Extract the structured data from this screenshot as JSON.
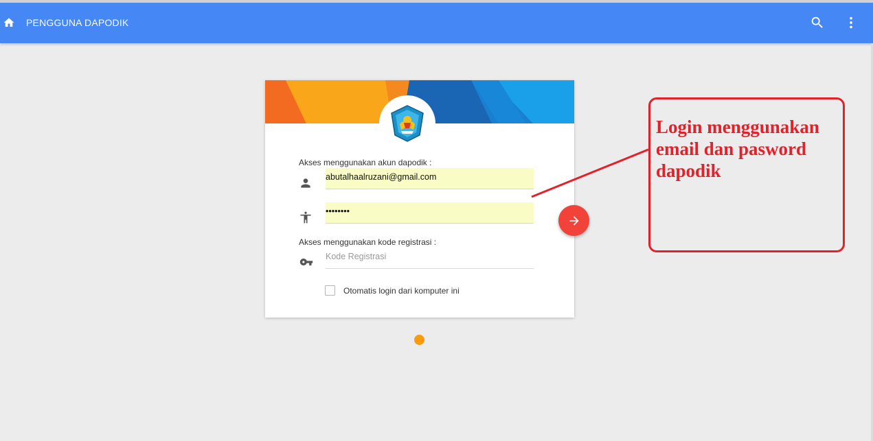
{
  "appbar": {
    "title": "PENGGUNA DAPODIK",
    "home_icon": "home-icon",
    "search_icon": "search-icon",
    "more_icon": "more-vert-icon",
    "color": "#4587f4"
  },
  "login_card": {
    "logo": "kemdikbud-logo",
    "account_section_label": "Akses menggunakan akun dapodik :",
    "email_field": {
      "value": "abutalhaalruzani@gmail.com",
      "icon": "person-icon"
    },
    "password_field": {
      "value": "••••••••",
      "icon": "accessibility-icon"
    },
    "registration_section_label": "Akses menggunakan kode registrasi :",
    "registration_field": {
      "placeholder": "Kode Registrasi",
      "icon": "key-icon"
    },
    "auto_login_label": "Otomatis login dari komputer ini",
    "auto_login_checked": false
  },
  "submit_button": {
    "icon": "arrow-right-icon",
    "color": "#f2433b"
  },
  "annotation": {
    "text": "Login menggunakan email dan pasword dapodik",
    "color": "#e3212a"
  },
  "loading_dot_color": "#fb9a0b"
}
